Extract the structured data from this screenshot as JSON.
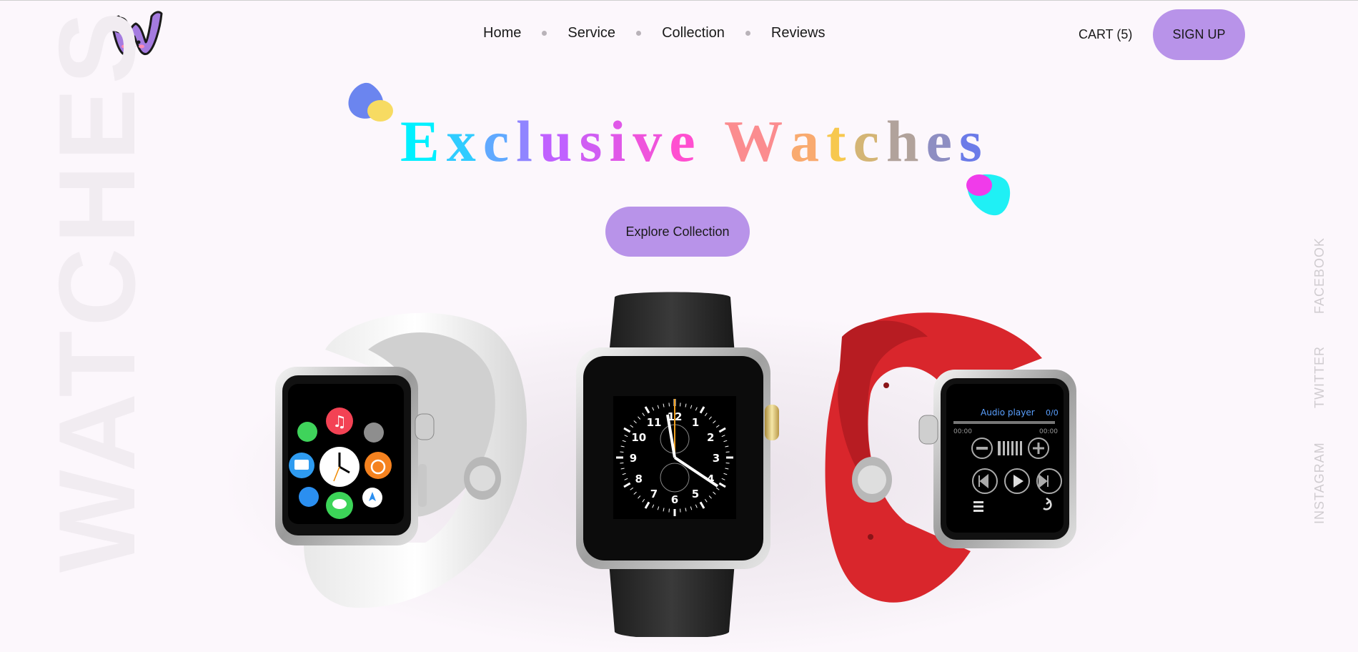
{
  "nav": {
    "links": [
      "Home",
      "Service",
      "Collection",
      "Reviews"
    ],
    "cart_label": "CART (5)",
    "signup_label": "SIGN UP"
  },
  "hero": {
    "side_text": "WATCHES",
    "headline": "Exclusive Watches",
    "cta_label": "Explore Collection"
  },
  "social": [
    "FACEBOOK",
    "TWITTER",
    "INSTAGRAM"
  ],
  "watches": {
    "left": {
      "color": "white",
      "apps": [
        "phone-icon",
        "music-icon",
        "settings-icon",
        "mail-icon",
        "clock-icon",
        "timer-icon",
        "weather-icon",
        "messages-icon",
        "maps-icon"
      ]
    },
    "center": {
      "color": "black",
      "dial_numbers": [
        "12",
        "1",
        "2",
        "3",
        "4",
        "5",
        "6",
        "7",
        "8",
        "9",
        "10",
        "11"
      ]
    },
    "right": {
      "color": "red",
      "screen_title": "Audio player",
      "track_count": "0/0",
      "time_left": "00:00",
      "time_right": "00:00"
    }
  },
  "colors": {
    "accent": "#b893e9",
    "background": "#fcf7fc",
    "red_band": "#d9262c",
    "headline_gradient": [
      "#00f0ff",
      "#c061ff",
      "#ff4fd0",
      "#f7c84e",
      "#6b7be8"
    ]
  }
}
